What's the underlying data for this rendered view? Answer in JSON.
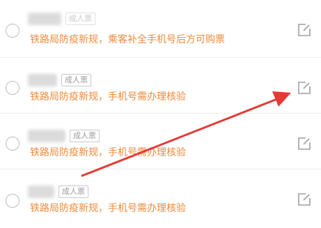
{
  "passengers": [
    {
      "ticket_type": "成人票",
      "notice": "铁路局防疫新规，乘客补全手机号后方可购票",
      "icons": {
        "select": "radio-icon",
        "edit": "edit-icon"
      }
    },
    {
      "ticket_type": "成人票",
      "notice": "铁路局防疫新规，手机号需办理核验",
      "icons": {
        "select": "radio-icon",
        "edit": "edit-icon"
      }
    },
    {
      "ticket_type": "成人票",
      "notice": "铁路局防疫新规，手机号需办理核验",
      "icons": {
        "select": "radio-icon",
        "edit": "edit-icon"
      }
    },
    {
      "ticket_type": "成人票",
      "notice": "铁路局防疫新规，手机号需办理核验",
      "icons": {
        "select": "radio-icon",
        "edit": "edit-icon"
      }
    }
  ],
  "colors": {
    "notice": "#f08a3c",
    "arrow": "#e53935",
    "badge_border": "#c8c8c8",
    "badge_text": "#9a9a9a"
  },
  "annotation": {
    "icon": "red-arrow-icon",
    "target": "edit-icon"
  }
}
